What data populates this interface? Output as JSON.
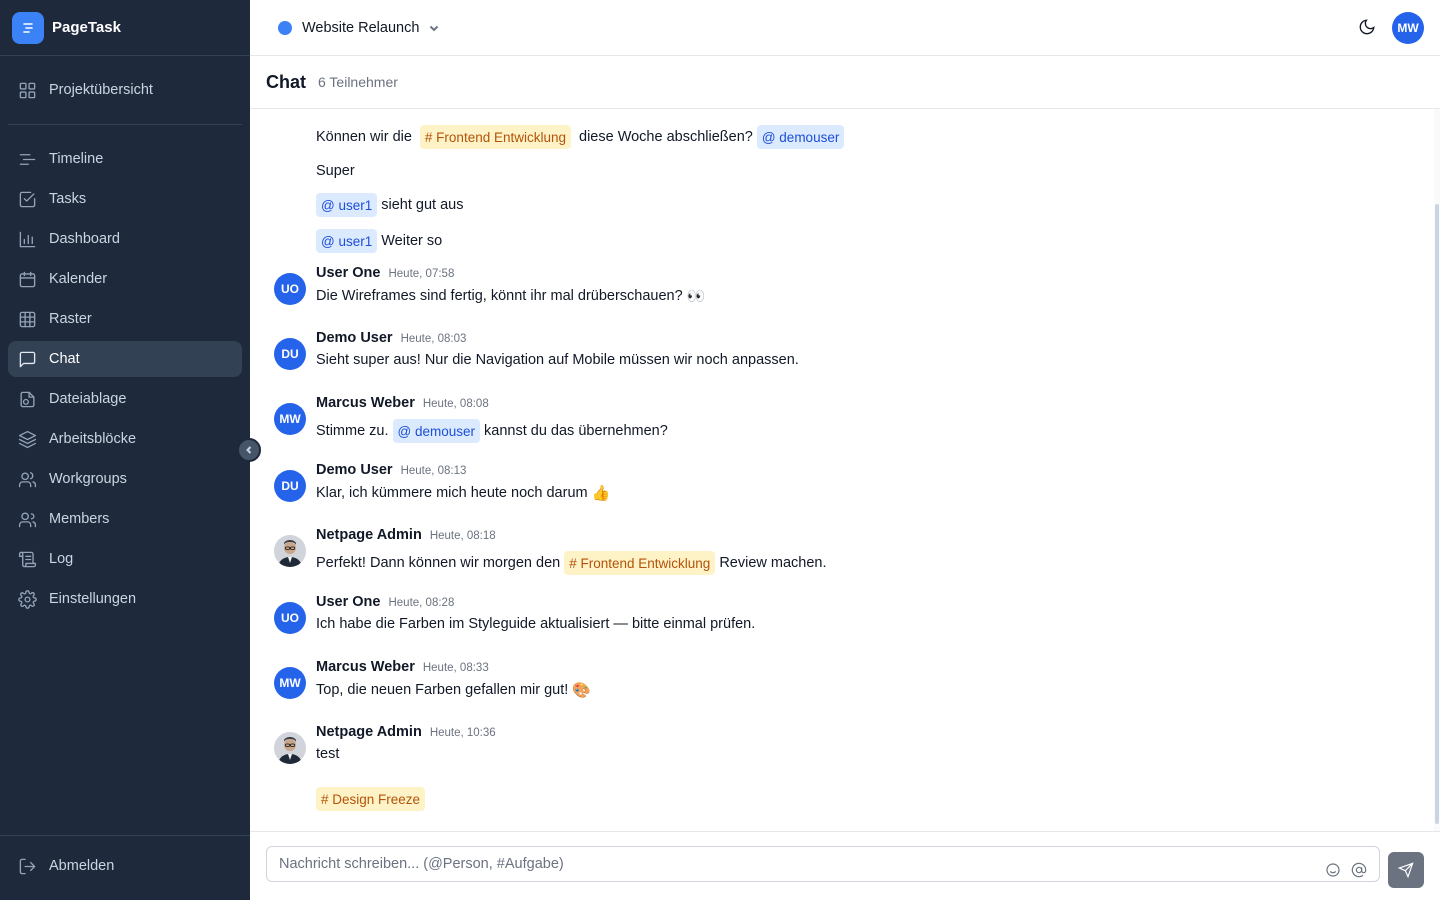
{
  "app": {
    "name": "PageTask"
  },
  "sidebar": {
    "overview": {
      "label": "Projektübersicht",
      "icon": "grid-icon"
    },
    "items": [
      {
        "label": "Timeline",
        "icon": "timeline-icon"
      },
      {
        "label": "Tasks",
        "icon": "checkbox-icon"
      },
      {
        "label": "Dashboard",
        "icon": "bar-chart-icon"
      },
      {
        "label": "Kalender",
        "icon": "calendar-icon"
      },
      {
        "label": "Raster",
        "icon": "table-icon"
      },
      {
        "label": "Chat",
        "icon": "chat-icon",
        "active": true
      },
      {
        "label": "Dateiablage",
        "icon": "files-icon"
      },
      {
        "label": "Arbeitsblöcke",
        "icon": "layers-icon"
      },
      {
        "label": "Workgroups",
        "icon": "users-icon"
      },
      {
        "label": "Members",
        "icon": "members-icon"
      },
      {
        "label": "Log",
        "icon": "scroll-icon"
      },
      {
        "label": "Einstellungen",
        "icon": "gear-icon"
      }
    ],
    "logout": {
      "label": "Abmelden",
      "icon": "logout-icon"
    }
  },
  "topbar": {
    "project": "Website Relaunch",
    "project_color": "#3b82f6",
    "user_initials": "MW"
  },
  "chat": {
    "title": "Chat",
    "participants": "6 Teilnehmer"
  },
  "earlier": {
    "line1": {
      "before": "Können wir die",
      "tag": "# Frontend Entwicklung",
      "after": "diese Woche abschließen?",
      "mention": "@ demouser"
    },
    "line2": "Super",
    "line3": {
      "mention": "@ user1",
      "text": "sieht gut aus"
    },
    "line4": {
      "mention": "@ user1",
      "text": "Weiter so"
    }
  },
  "messages": [
    {
      "initials": "UO",
      "author": "User One",
      "time": "Heute, 07:58",
      "text": "Die Wireframes sind fertig, könnt ihr mal drüberschauen?",
      "emoji": "👀"
    },
    {
      "initials": "DU",
      "author": "Demo User",
      "time": "Heute, 08:03",
      "text": "Sieht super aus! Nur die Navigation auf Mobile müssen wir noch anpassen."
    },
    {
      "initials": "MW",
      "author": "Marcus Weber",
      "time": "Heute, 08:08",
      "before": "Stimme zu.",
      "mention": "@ demouser",
      "after": "kannst du das übernehmen?"
    },
    {
      "initials": "DU",
      "author": "Demo User",
      "time": "Heute, 08:13",
      "text": "Klar, ich kümmere mich heute noch darum",
      "emoji": "👍"
    },
    {
      "initials": "",
      "author": "Netpage Admin",
      "time": "Heute, 08:18",
      "before": "Perfekt! Dann können wir morgen den",
      "tag": "# Frontend Entwicklung",
      "after": "Review machen."
    },
    {
      "initials": "UO",
      "author": "User One",
      "time": "Heute, 08:28",
      "text": "Ich habe die Farben im Styleguide aktualisiert — bitte einmal prüfen."
    },
    {
      "initials": "MW",
      "author": "Marcus Weber",
      "time": "Heute, 08:33",
      "text": "Top, die neuen Farben gefallen mir gut!",
      "emoji": "🎨"
    },
    {
      "initials": "",
      "author": "Netpage Admin",
      "time": "Heute, 10:36",
      "text": "test",
      "tag": "# Design Freeze"
    }
  ],
  "composer": {
    "placeholder": "Nachricht schreiben... (@Person, #Aufgabe)"
  },
  "colors": {
    "sidebar_bg": "#1e293b",
    "accent": "#2563eb",
    "mention_bg": "#dbeafe",
    "tag_bg": "#fef3c7"
  }
}
